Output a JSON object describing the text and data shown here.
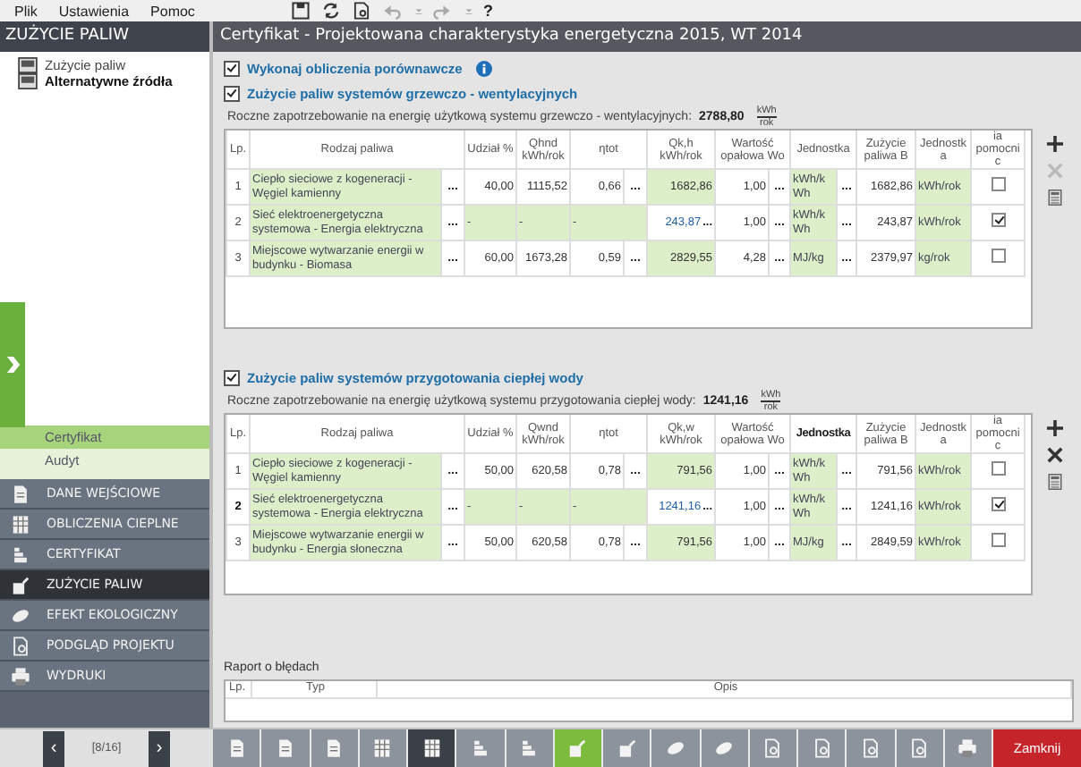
{
  "menu": [
    {
      "label": "Plik"
    },
    {
      "label": "Ustawienia"
    },
    {
      "label": "Pomoc"
    }
  ],
  "toolbar": [
    {
      "kind": "save",
      "disabled": false
    },
    {
      "kind": "refresh",
      "disabled": false
    },
    {
      "kind": "preview",
      "disabled": false
    },
    {
      "kind": "undo",
      "disabled": true
    },
    {
      "kind": "dropdown",
      "disabled": true
    },
    {
      "kind": "redo",
      "disabled": true
    },
    {
      "kind": "dropdown",
      "disabled": true
    }
  ],
  "help_label": "?",
  "sidebar": {
    "title": "ZUŻYCIE PALIW",
    "tree": [
      {
        "label": "Zużycie paliw",
        "selected": false
      },
      {
        "label": "Alternatywne źródła",
        "selected": true
      }
    ],
    "modes": [
      {
        "label": "Certyfikat",
        "selected": true
      },
      {
        "label": "Audyt",
        "selected": false
      }
    ],
    "nav": [
      {
        "label": "DANE WEJŚCIOWE",
        "kind": "doc",
        "selected": false
      },
      {
        "label": "OBLICZENIA CIEPLNE",
        "kind": "calc",
        "selected": false
      },
      {
        "label": "CERTYFIKAT",
        "kind": "cert",
        "selected": false
      },
      {
        "label": "ZUŻYCIE PALIW",
        "kind": "fuel",
        "selected": true
      },
      {
        "label": "EFEKT EKOLOGICZNY",
        "kind": "leaf",
        "selected": false
      },
      {
        "label": "PODGLĄD PROJEKTU",
        "kind": "preview",
        "selected": false
      },
      {
        "label": "WYDRUKI",
        "kind": "printer",
        "selected": false
      }
    ]
  },
  "main": {
    "title": "Certyfikat - Projektowana charakterystyka energetyczna 2015, WT 2014",
    "compare": {
      "label": "Wykonaj obliczenia porównawcze",
      "checked": true
    },
    "more_label": "...",
    "sections": [
      {
        "label": "Zużycie paliw systemów grzewczo - wentylacyjnych",
        "checked": true,
        "demand_label": "Roczne zapotrzebowanie na energię użytkową systemu grzewczo - wentylacyjnych:",
        "demand_value": "2788,80",
        "demand_unit_top": "kWh",
        "demand_unit_bottom": "rok",
        "delete_disabled": true,
        "columns": [
          {
            "label": "Lp.",
            "bold": false
          },
          {
            "label": "Rodzaj paliwa",
            "bold": false
          },
          {
            "label": "Udział %",
            "bold": false
          },
          {
            "label": "Qhnd kWh/rok",
            "bold": false
          },
          {
            "label": "ηtot",
            "bold": false
          },
          {
            "label": "Qk,h kWh/rok",
            "bold": false
          },
          {
            "label": "Wartość opałowa Wo",
            "bold": false
          },
          {
            "label": "Jednostka",
            "bold": false
          },
          {
            "label": "Zużycie paliwa B",
            "bold": false
          },
          {
            "label": "Jednostka",
            "bold": false
          },
          {
            "label": "ia pomocnic",
            "bold": false
          }
        ],
        "rows": [
          {
            "lp": "1",
            "fuel": "Ciepło sieciowe z kogeneracji - Węgiel kamienny",
            "kind": "fuel",
            "share": "40,00",
            "qnd": "1115,52",
            "eta": "0,66",
            "qk": "1682,86",
            "wo": "1,00",
            "unit": "kWh/kWh",
            "usage": "1682,86",
            "usage_unit": "kWh/rok",
            "auxiliary": false,
            "selected": false
          },
          {
            "lp": "2",
            "fuel": "Sieć elektroenergetyczna systemowa - Energia elektryczna",
            "kind": "electric",
            "share": "-",
            "qnd": "-",
            "eta": "-",
            "qk": "243,87",
            "wo": "1,00",
            "unit": "kWh/kWh",
            "usage": "243,87",
            "usage_unit": "kWh/rok",
            "auxiliary": true,
            "selected": false
          },
          {
            "lp": "3",
            "fuel": "Miejscowe wytwarzanie energii w budynku - Biomasa",
            "kind": "fuel",
            "share": "60,00",
            "qnd": "1673,28",
            "eta": "0,59",
            "qk": "2829,55",
            "wo": "4,28",
            "unit": "MJ/kg",
            "usage": "2379,97",
            "usage_unit": "kg/rok",
            "auxiliary": false,
            "selected": false
          }
        ]
      },
      {
        "label": "Zużycie paliw systemów przygotowania ciepłej wody",
        "checked": true,
        "demand_label": "Roczne zapotrzebowanie na energię użytkową systemu przygotowania ciepłej wody:",
        "demand_value": "1241,16",
        "demand_unit_top": "kWh",
        "demand_unit_bottom": "rok",
        "delete_disabled": false,
        "columns": [
          {
            "label": "Lp.",
            "bold": false
          },
          {
            "label": "Rodzaj paliwa",
            "bold": false
          },
          {
            "label": "Udział %",
            "bold": false
          },
          {
            "label": "Qwnd kWh/rok",
            "bold": false
          },
          {
            "label": "ηtot",
            "bold": false
          },
          {
            "label": "Qk,w kWh/rok",
            "bold": false
          },
          {
            "label": "Wartość opałowa Wo",
            "bold": false
          },
          {
            "label": "Jednostka",
            "bold": true
          },
          {
            "label": "Zużycie paliwa B",
            "bold": false
          },
          {
            "label": "Jednostka",
            "bold": false
          },
          {
            "label": "ia pomocnic",
            "bold": false
          }
        ],
        "rows": [
          {
            "lp": "1",
            "fuel": "Ciepło sieciowe z kogeneracji - Węgiel kamienny",
            "kind": "fuel",
            "share": "50,00",
            "qnd": "620,58",
            "eta": "0,78",
            "qk": "791,56",
            "wo": "1,00",
            "unit": "kWh/kWh",
            "usage": "791,56",
            "usage_unit": "kWh/rok",
            "auxiliary": false,
            "selected": false
          },
          {
            "lp": "2",
            "fuel": "Sieć elektroenergetyczna systemowa - Energia elektryczna",
            "kind": "electric",
            "share": "-",
            "qnd": "-",
            "eta": "-",
            "qk": "1241,16",
            "wo": "1,00",
            "unit": "kWh/kWh",
            "usage": "1241,16",
            "usage_unit": "kWh/rok",
            "auxiliary": true,
            "selected": true
          },
          {
            "lp": "3",
            "fuel": "Miejscowe wytwarzanie energii w budynku - Energia słoneczna",
            "kind": "fuel",
            "share": "50,00",
            "qnd": "620,58",
            "eta": "0,78",
            "qk": "791,56",
            "wo": "1,00",
            "unit": "MJ/kg",
            "usage": "2849,59",
            "usage_unit": "kWh/rok",
            "auxiliary": false,
            "selected": false
          }
        ]
      }
    ],
    "report": {
      "title": "Raport o błędach",
      "columns": [
        {
          "label": "Lp."
        },
        {
          "label": "Typ"
        },
        {
          "label": "Opis"
        }
      ]
    }
  },
  "footer": {
    "prev": "‹",
    "page": "[8/16]",
    "next": "›",
    "buttons": [
      {
        "kind": "doc",
        "selected": false,
        "pressed": false
      },
      {
        "kind": "doc",
        "selected": false,
        "pressed": false
      },
      {
        "kind": "doc",
        "selected": false,
        "pressed": false
      },
      {
        "kind": "calc",
        "selected": false,
        "pressed": false
      },
      {
        "kind": "calc",
        "selected": false,
        "pressed": true
      },
      {
        "kind": "cert",
        "selected": false,
        "pressed": false
      },
      {
        "kind": "cert",
        "selected": false,
        "pressed": false
      },
      {
        "kind": "fuel",
        "selected": true,
        "pressed": false
      },
      {
        "kind": "fuel",
        "selected": false,
        "pressed": false
      },
      {
        "kind": "leaf",
        "selected": false,
        "pressed": false
      },
      {
        "kind": "leaf",
        "selected": false,
        "pressed": false
      },
      {
        "kind": "preview",
        "selected": false,
        "pressed": false
      },
      {
        "kind": "preview",
        "selected": false,
        "pressed": false
      },
      {
        "kind": "preview",
        "selected": false,
        "pressed": false
      },
      {
        "kind": "preview",
        "selected": false,
        "pressed": false
      },
      {
        "kind": "printer",
        "selected": false,
        "pressed": false
      }
    ],
    "close": "Zamknij"
  }
}
